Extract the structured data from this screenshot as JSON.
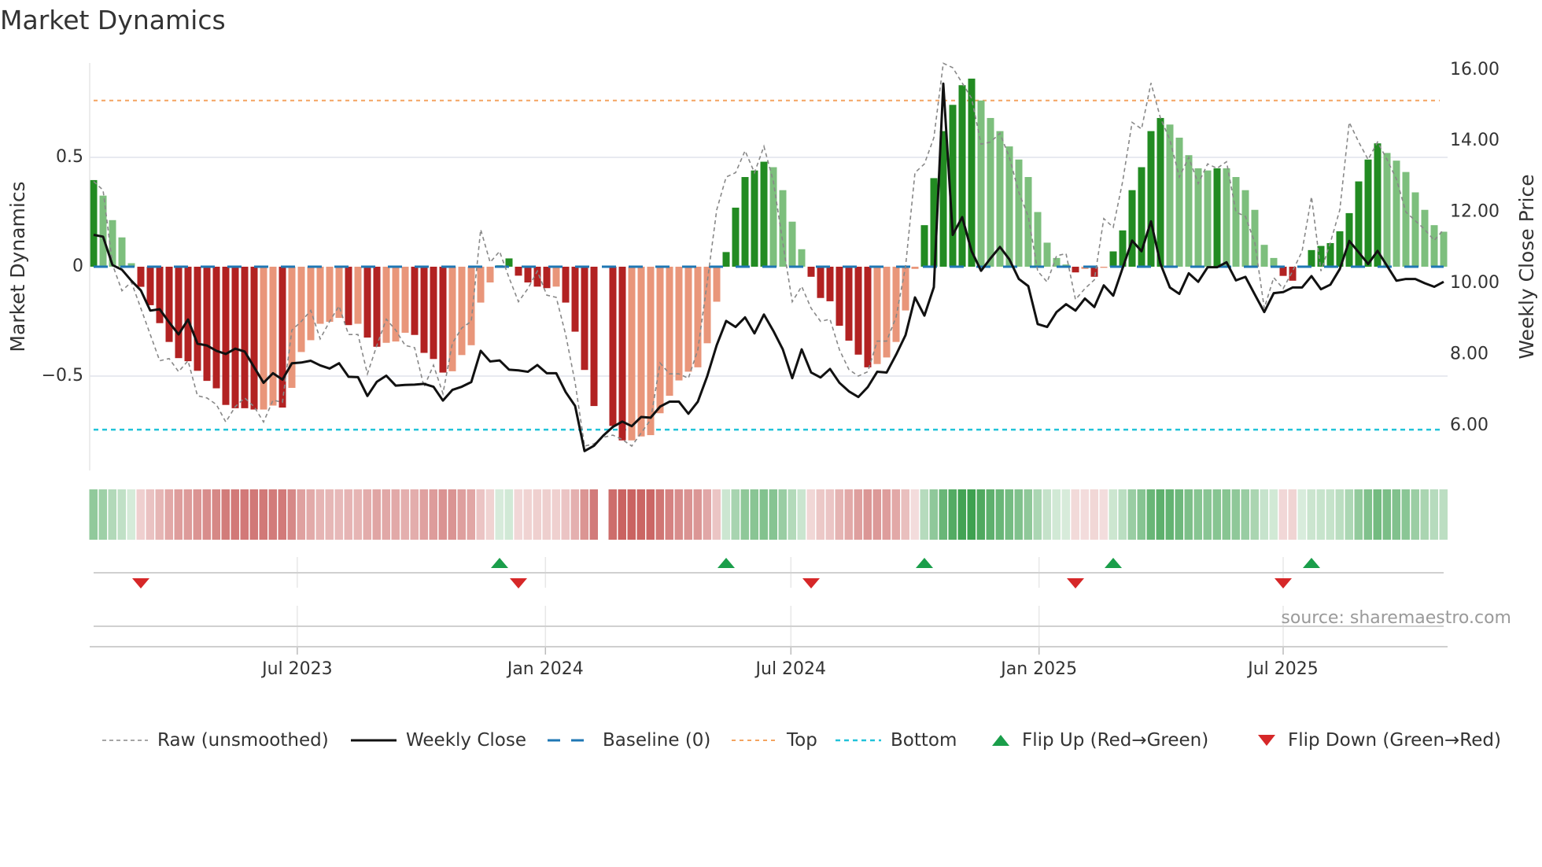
{
  "title": "Market Dynamics",
  "source": "source: sharemaestro.com",
  "colors": {
    "dark_green": "#228b22",
    "light_green": "#7dbf7d",
    "dark_red": "#b22222",
    "light_red": "#e9967a",
    "close": "#111111",
    "raw": "#888888",
    "baseline": "#1f77b4",
    "top": "#f4a460",
    "bottom": "#22c3d9",
    "flip_up": "#1a9e4a",
    "flip_down": "#d62728"
  },
  "legend": [
    {
      "key": "raw",
      "label": "Raw (unsmoothed)"
    },
    {
      "key": "close",
      "label": "Weekly Close"
    },
    {
      "key": "baseline",
      "label": "Baseline (0)"
    },
    {
      "key": "top",
      "label": "Top"
    },
    {
      "key": "bottom",
      "label": "Bottom"
    },
    {
      "key": "flip_up",
      "label": "Flip Up (Red→Green)"
    },
    {
      "key": "flip_down",
      "label": "Flip Down (Green→Red)"
    }
  ],
  "chart_data": {
    "type": "bar",
    "title": "Market Dynamics",
    "ylabel": "Market Dynamics",
    "y2label": "Weekly Close Price",
    "frequency": "weekly",
    "start_date": "2023-01-31",
    "ylim": [
      -0.93,
      0.93
    ],
    "y2lim": [
      4.73,
      16.2
    ],
    "y_ticks": [
      {
        "v": 0.5,
        "label": "0.5"
      },
      {
        "v": 0,
        "label": "0"
      },
      {
        "v": -0.5,
        "label": "−0.5"
      }
    ],
    "y2_ticks": [
      {
        "v": 16,
        "label": "16.00"
      },
      {
        "v": 14,
        "label": "14.00"
      },
      {
        "v": 12,
        "label": "12.00"
      },
      {
        "v": 10,
        "label": "10.00"
      },
      {
        "v": 8,
        "label": "8.00"
      },
      {
        "v": 6,
        "label": "6.00"
      }
    ],
    "x_ticks": [
      {
        "date": "2023-07-01",
        "label": "Jul 2023"
      },
      {
        "date": "2024-01-01",
        "label": "Jan 2024"
      },
      {
        "date": "2024-07-01",
        "label": "Jul 2024"
      },
      {
        "date": "2025-01-01",
        "label": "Jan 2025"
      },
      {
        "date": "2025-07-01",
        "label": "Jul 2025"
      }
    ],
    "grid": true,
    "legend_position": "bottom",
    "baseline": 0,
    "top": 0.76,
    "bottom": -0.745,
    "dynamics": [
      0.396,
      0.325,
      0.213,
      0.134,
      0.016,
      -0.092,
      -0.176,
      -0.258,
      -0.344,
      -0.418,
      -0.432,
      -0.476,
      -0.522,
      -0.556,
      -0.632,
      -0.647,
      -0.647,
      -0.653,
      -0.653,
      -0.635,
      -0.644,
      -0.554,
      -0.39,
      -0.336,
      -0.261,
      -0.252,
      -0.234,
      -0.267,
      -0.261,
      -0.324,
      -0.366,
      -0.348,
      -0.342,
      -0.302,
      -0.312,
      -0.394,
      -0.422,
      -0.484,
      -0.478,
      -0.404,
      -0.359,
      -0.164,
      -0.072,
      0.007,
      0.038,
      -0.041,
      -0.072,
      -0.091,
      -0.098,
      -0.091,
      -0.164,
      -0.297,
      -0.472,
      -0.637,
      null,
      -0.728,
      -0.794,
      -0.794,
      -0.776,
      -0.77,
      -0.67,
      -0.59,
      -0.52,
      -0.48,
      -0.46,
      -0.35,
      -0.16,
      0.067,
      0.27,
      0.41,
      0.44,
      0.48,
      0.455,
      0.35,
      0.206,
      0.08,
      -0.046,
      -0.143,
      -0.158,
      -0.27,
      -0.338,
      -0.402,
      -0.46,
      -0.445,
      -0.415,
      -0.344,
      -0.2,
      -0.01,
      0.19,
      0.405,
      0.62,
      0.74,
      0.83,
      0.86,
      0.76,
      0.68,
      0.62,
      0.55,
      0.49,
      0.41,
      0.25,
      0.11,
      0.04,
      0.01,
      -0.026,
      -0.01,
      -0.046,
      -0.005,
      0.07,
      0.166,
      0.35,
      0.455,
      0.62,
      0.68,
      0.65,
      0.59,
      0.51,
      0.45,
      0.44,
      0.45,
      0.45,
      0.41,
      0.35,
      0.26,
      0.1,
      0.04,
      -0.042,
      -0.064,
      0,
      0.076,
      0.095,
      0.108,
      0.162,
      0.245,
      0.39,
      0.49,
      0.564,
      0.52,
      0.485,
      0.433,
      0.34,
      0.26,
      0.19,
      0.16
    ],
    "dark_shade": [
      1,
      0,
      0,
      0,
      0,
      1,
      1,
      1,
      1,
      1,
      1,
      1,
      1,
      1,
      1,
      1,
      1,
      1,
      0,
      0,
      1,
      0,
      0,
      0,
      0,
      0,
      0,
      1,
      0,
      1,
      1,
      0,
      0,
      0,
      1,
      1,
      1,
      1,
      0,
      0,
      0,
      0,
      0,
      0,
      1,
      1,
      1,
      1,
      1,
      0,
      1,
      1,
      1,
      1,
      0,
      1,
      1,
      0,
      0,
      0,
      0,
      0,
      0,
      0,
      0,
      0,
      0,
      1,
      1,
      1,
      1,
      1,
      0,
      0,
      0,
      0,
      1,
      1,
      1,
      1,
      1,
      1,
      1,
      0,
      0,
      0,
      0,
      0,
      1,
      1,
      1,
      1,
      1,
      1,
      0,
      0,
      0,
      0,
      0,
      0,
      0,
      0,
      0,
      0,
      1,
      0,
      1,
      0,
      1,
      1,
      1,
      1,
      1,
      1,
      0,
      0,
      0,
      0,
      0,
      1,
      0,
      0,
      0,
      0,
      0,
      0,
      1,
      1,
      0,
      1,
      1,
      1,
      1,
      1,
      1,
      1,
      1,
      0,
      0,
      0,
      0,
      0,
      0,
      0
    ],
    "raw": [
      0.39,
      0.35,
      0.01,
      -0.11,
      -0.07,
      -0.19,
      -0.31,
      -0.43,
      -0.42,
      -0.48,
      -0.43,
      -0.59,
      -0.6,
      -0.63,
      -0.71,
      -0.64,
      -0.6,
      -0.64,
      -0.71,
      -0.61,
      -0.62,
      -0.29,
      -0.25,
      -0.2,
      -0.33,
      -0.25,
      -0.18,
      -0.31,
      -0.31,
      -0.49,
      -0.36,
      -0.24,
      -0.29,
      -0.36,
      -0.37,
      -0.55,
      -0.45,
      -0.58,
      -0.35,
      -0.28,
      -0.25,
      0.17,
      0.02,
      0.07,
      -0.05,
      -0.16,
      -0.1,
      -0.02,
      -0.13,
      -0.14,
      -0.31,
      -0.53,
      -0.82,
      -0.81,
      -0.78,
      -0.77,
      -0.79,
      -0.82,
      -0.76,
      -0.7,
      -0.44,
      -0.49,
      -0.49,
      -0.51,
      -0.38,
      -0.07,
      0.26,
      0.41,
      0.43,
      0.53,
      0.43,
      0.55,
      0.39,
      0.11,
      -0.16,
      -0.09,
      -0.19,
      -0.25,
      -0.24,
      -0.38,
      -0.47,
      -0.5,
      -0.48,
      -0.34,
      -0.34,
      -0.23,
      0,
      0.43,
      0.47,
      0.59,
      0.93,
      0.91,
      0.84,
      0.77,
      0.56,
      0.57,
      0.61,
      0.5,
      0.34,
      0.23,
      -0.02,
      -0.07,
      0.05,
      0.06,
      -0.15,
      -0.1,
      -0.06,
      0.22,
      0.18,
      0.39,
      0.66,
      0.63,
      0.84,
      0.68,
      0.58,
      0.41,
      0.5,
      0.38,
      0.47,
      0.45,
      0.48,
      0.25,
      0.23,
      0.11,
      -0.19,
      -0.05,
      -0.1,
      -0.02,
      0.07,
      0.32,
      -0.02,
      0.11,
      0.26,
      0.66,
      0.57,
      0.49,
      0.57,
      0.49,
      0.4,
      0.25,
      0.21,
      0.17,
      0.12,
      0.17
    ],
    "close": [
      11.36,
      11.31,
      10.51,
      10.38,
      10.07,
      9.8,
      9.23,
      9.27,
      8.9,
      8.56,
      8.98,
      8.3,
      8.25,
      8.1,
      8.01,
      8.16,
      8.08,
      7.64,
      7.2,
      7.47,
      7.29,
      7.75,
      7.77,
      7.82,
      7.69,
      7.6,
      7.75,
      7.37,
      7.36,
      6.83,
      7.23,
      7.4,
      7.12,
      7.14,
      7.15,
      7.17,
      7.09,
      6.7,
      7.0,
      7.09,
      7.22,
      8.1,
      7.8,
      7.83,
      7.57,
      7.55,
      7.51,
      7.7,
      7.47,
      7.47,
      6.94,
      6.55,
      5.28,
      5.43,
      5.72,
      5.96,
      6.11,
      5.98,
      6.24,
      6.22,
      6.53,
      6.67,
      6.67,
      6.33,
      6.67,
      7.39,
      8.26,
      8.94,
      8.77,
      9.04,
      8.59,
      9.12,
      8.66,
      8.14,
      7.33,
      8.14,
      7.49,
      7.35,
      7.59,
      7.2,
      6.96,
      6.8,
      7.08,
      7.51,
      7.49,
      7.99,
      8.54,
      9.6,
      9.09,
      9.89,
      15.61,
      11.36,
      11.86,
      10.9,
      10.35,
      10.7,
      11.02,
      10.67,
      10.12,
      9.92,
      8.85,
      8.77,
      9.19,
      9.41,
      9.23,
      9.57,
      9.33,
      9.94,
      9.65,
      10.43,
      11.2,
      10.9,
      11.74,
      10.55,
      9.88,
      9.7,
      10.28,
      10.04,
      10.45,
      10.45,
      10.59,
      10.08,
      10.18,
      9.68,
      9.19,
      9.72,
      9.75,
      9.88,
      9.88,
      10.2,
      9.83,
      9.96,
      10.4,
      11.19,
      10.87,
      10.54,
      10.91,
      10.49,
      10.07,
      10.12,
      10.12,
      10.0,
      9.9,
      10.04
    ],
    "flip_up_weeks": [
      43,
      67,
      88,
      108,
      129
    ],
    "flip_down_weeks": [
      5,
      45,
      76,
      104,
      126
    ]
  }
}
